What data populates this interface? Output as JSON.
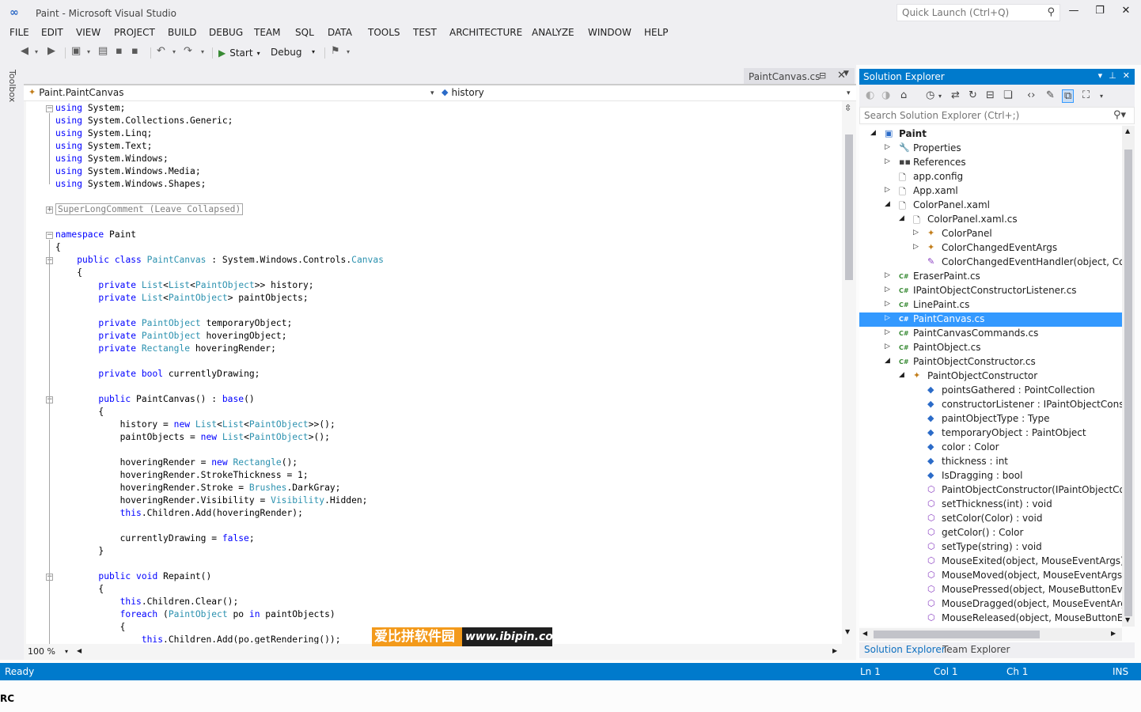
{
  "window": {
    "title": "Paint - Microsoft Visual Studio",
    "quick_launch_placeholder": "Quick Launch (Ctrl+Q)"
  },
  "menu": [
    "FILE",
    "EDIT",
    "VIEW",
    "PROJECT",
    "BUILD",
    "DEBUG",
    "TEAM",
    "SQL",
    "DATA",
    "TOOLS",
    "TEST",
    "ARCHITECTURE",
    "ANALYZE",
    "WINDOW",
    "HELP"
  ],
  "toolbar": {
    "start_label": "Start",
    "config_label": "Debug"
  },
  "toolbox_label": "Toolbox",
  "document_tab": {
    "label": "PaintCanvas.cs"
  },
  "navigation": {
    "left": "Paint.PaintCanvas",
    "right": "history"
  },
  "editor": {
    "zoom": "100 %",
    "lines": [
      [
        [
          "kw",
          "using"
        ],
        [
          "p",
          " System;"
        ]
      ],
      [
        [
          "kw",
          "using"
        ],
        [
          "p",
          " System.Collections.Generic;"
        ]
      ],
      [
        [
          "kw",
          "using"
        ],
        [
          "p",
          " System.Linq;"
        ]
      ],
      [
        [
          "kw",
          "using"
        ],
        [
          "p",
          " System.Text;"
        ]
      ],
      [
        [
          "kw",
          "using"
        ],
        [
          "p",
          " System.Windows;"
        ]
      ],
      [
        [
          "kw",
          "using"
        ],
        [
          "p",
          " System.Windows.Media;"
        ]
      ],
      [
        [
          "kw",
          "using"
        ],
        [
          "p",
          " System.Windows.Shapes;"
        ]
      ],
      [],
      [
        [
          "box",
          "SuperLongComment (Leave Collapsed)"
        ]
      ],
      [],
      [
        [
          "kw",
          "namespace"
        ],
        [
          "p",
          " Paint"
        ]
      ],
      [
        [
          "p",
          "{"
        ]
      ],
      [
        [
          "p",
          "    "
        ],
        [
          "kw",
          "public"
        ],
        [
          "p",
          " "
        ],
        [
          "kw",
          "class"
        ],
        [
          "p",
          " "
        ],
        [
          "ty",
          "PaintCanvas"
        ],
        [
          "p",
          " : System.Windows.Controls."
        ],
        [
          "ty",
          "Canvas"
        ]
      ],
      [
        [
          "p",
          "    {"
        ]
      ],
      [
        [
          "p",
          "        "
        ],
        [
          "kw",
          "private"
        ],
        [
          "p",
          " "
        ],
        [
          "ty",
          "List"
        ],
        [
          "p",
          "<"
        ],
        [
          "ty",
          "List"
        ],
        [
          "p",
          "<"
        ],
        [
          "ty",
          "PaintObject"
        ],
        [
          "p",
          ">> history;"
        ]
      ],
      [
        [
          "p",
          "        "
        ],
        [
          "kw",
          "private"
        ],
        [
          "p",
          " "
        ],
        [
          "ty",
          "List"
        ],
        [
          "p",
          "<"
        ],
        [
          "ty",
          "PaintObject"
        ],
        [
          "p",
          "> paintObjects;"
        ]
      ],
      [],
      [
        [
          "p",
          "        "
        ],
        [
          "kw",
          "private"
        ],
        [
          "p",
          " "
        ],
        [
          "ty",
          "PaintObject"
        ],
        [
          "p",
          " temporaryObject;"
        ]
      ],
      [
        [
          "p",
          "        "
        ],
        [
          "kw",
          "private"
        ],
        [
          "p",
          " "
        ],
        [
          "ty",
          "PaintObject"
        ],
        [
          "p",
          " hoveringObject;"
        ]
      ],
      [
        [
          "p",
          "        "
        ],
        [
          "kw",
          "private"
        ],
        [
          "p",
          " "
        ],
        [
          "ty",
          "Rectangle"
        ],
        [
          "p",
          " hoveringRender;"
        ]
      ],
      [],
      [
        [
          "p",
          "        "
        ],
        [
          "kw",
          "private"
        ],
        [
          "p",
          " "
        ],
        [
          "kw",
          "bool"
        ],
        [
          "p",
          " currentlyDrawing;"
        ]
      ],
      [],
      [
        [
          "p",
          "        "
        ],
        [
          "kw",
          "public"
        ],
        [
          "p",
          " PaintCanvas() : "
        ],
        [
          "kw",
          "base"
        ],
        [
          "p",
          "()"
        ]
      ],
      [
        [
          "p",
          "        {"
        ]
      ],
      [
        [
          "p",
          "            history = "
        ],
        [
          "kw",
          "new"
        ],
        [
          "p",
          " "
        ],
        [
          "ty",
          "List"
        ],
        [
          "p",
          "<"
        ],
        [
          "ty",
          "List"
        ],
        [
          "p",
          "<"
        ],
        [
          "ty",
          "PaintObject"
        ],
        [
          "p",
          ">>();"
        ]
      ],
      [
        [
          "p",
          "            paintObjects = "
        ],
        [
          "kw",
          "new"
        ],
        [
          "p",
          " "
        ],
        [
          "ty",
          "List"
        ],
        [
          "p",
          "<"
        ],
        [
          "ty",
          "PaintObject"
        ],
        [
          "p",
          ">();"
        ]
      ],
      [],
      [
        [
          "p",
          "            hoveringRender = "
        ],
        [
          "kw",
          "new"
        ],
        [
          "p",
          " "
        ],
        [
          "ty",
          "Rectangle"
        ],
        [
          "p",
          "();"
        ]
      ],
      [
        [
          "p",
          "            hoveringRender.StrokeThickness = 1;"
        ]
      ],
      [
        [
          "p",
          "            hoveringRender.Stroke = "
        ],
        [
          "ty",
          "Brushes"
        ],
        [
          "p",
          ".DarkGray;"
        ]
      ],
      [
        [
          "p",
          "            hoveringRender.Visibility = "
        ],
        [
          "ty",
          "Visibility"
        ],
        [
          "p",
          ".Hidden;"
        ]
      ],
      [
        [
          "p",
          "            "
        ],
        [
          "kw",
          "this"
        ],
        [
          "p",
          ".Children.Add(hoveringRender);"
        ]
      ],
      [],
      [
        [
          "p",
          "            currentlyDrawing = "
        ],
        [
          "kw",
          "false"
        ],
        [
          "p",
          ";"
        ]
      ],
      [
        [
          "p",
          "        }"
        ]
      ],
      [],
      [
        [
          "p",
          "        "
        ],
        [
          "kw",
          "public"
        ],
        [
          "p",
          " "
        ],
        [
          "kw",
          "void"
        ],
        [
          "p",
          " Repaint()"
        ]
      ],
      [
        [
          "p",
          "        {"
        ]
      ],
      [
        [
          "p",
          "            "
        ],
        [
          "kw",
          "this"
        ],
        [
          "p",
          ".Children.Clear();"
        ]
      ],
      [
        [
          "p",
          "            "
        ],
        [
          "kw",
          "foreach"
        ],
        [
          "p",
          " ("
        ],
        [
          "ty",
          "PaintObject"
        ],
        [
          "p",
          " po "
        ],
        [
          "kw",
          "in"
        ],
        [
          "p",
          " paintObjects)"
        ]
      ],
      [
        [
          "p",
          "            {"
        ]
      ],
      [
        [
          "p",
          "                "
        ],
        [
          "kw",
          "this"
        ],
        [
          "p",
          ".Children.Add(po.getRendering());"
        ]
      ]
    ]
  },
  "watermark": {
    "cn": "爱比拼软件园",
    "url": "www.ibipin.com"
  },
  "solution_explorer": {
    "title": "Solution Explorer",
    "search_placeholder": "Search Solution Explorer (Ctrl+;)",
    "tabs": [
      "Solution Explorer",
      "Team Explorer"
    ],
    "items": [
      {
        "label": "Paint",
        "depth": 0,
        "expander": "open",
        "icon": "project",
        "bold": true
      },
      {
        "label": "Properties",
        "depth": 1,
        "expander": "closed",
        "icon": "wrench"
      },
      {
        "label": "References",
        "depth": 1,
        "expander": "closed",
        "icon": "references"
      },
      {
        "label": "app.config",
        "depth": 1,
        "expander": "none",
        "icon": "file"
      },
      {
        "label": "App.xaml",
        "depth": 1,
        "expander": "closed",
        "icon": "xaml"
      },
      {
        "label": "ColorPanel.xaml",
        "depth": 1,
        "expander": "open",
        "icon": "xaml"
      },
      {
        "label": "ColorPanel.xaml.cs",
        "depth": 2,
        "expander": "open",
        "icon": "file"
      },
      {
        "label": "ColorPanel",
        "depth": 3,
        "expander": "closed",
        "icon": "class"
      },
      {
        "label": "ColorChangedEventArgs",
        "depth": 3,
        "expander": "closed",
        "icon": "class"
      },
      {
        "label": "ColorChangedEventHandler(object, ColorC",
        "depth": 3,
        "expander": "none",
        "icon": "delegate"
      },
      {
        "label": "EraserPaint.cs",
        "depth": 1,
        "expander": "closed",
        "icon": "cs"
      },
      {
        "label": "IPaintObjectConstructorListener.cs",
        "depth": 1,
        "expander": "closed",
        "icon": "cs"
      },
      {
        "label": "LinePaint.cs",
        "depth": 1,
        "expander": "closed",
        "icon": "cs"
      },
      {
        "label": "PaintCanvas.cs",
        "depth": 1,
        "expander": "closed",
        "icon": "cs",
        "selected": true
      },
      {
        "label": "PaintCanvasCommands.cs",
        "depth": 1,
        "expander": "closed",
        "icon": "cs"
      },
      {
        "label": "PaintObject.cs",
        "depth": 1,
        "expander": "closed",
        "icon": "cs"
      },
      {
        "label": "PaintObjectConstructor.cs",
        "depth": 1,
        "expander": "open",
        "icon": "cs"
      },
      {
        "label": "PaintObjectConstructor",
        "depth": 2,
        "expander": "open",
        "icon": "class"
      },
      {
        "label": "pointsGathered : PointCollection",
        "depth": 3,
        "expander": "none",
        "icon": "field"
      },
      {
        "label": "constructorListener : IPaintObjectConstruct",
        "depth": 3,
        "expander": "none",
        "icon": "field"
      },
      {
        "label": "paintObjectType : Type",
        "depth": 3,
        "expander": "none",
        "icon": "field"
      },
      {
        "label": "temporaryObject : PaintObject",
        "depth": 3,
        "expander": "none",
        "icon": "field"
      },
      {
        "label": "color : Color",
        "depth": 3,
        "expander": "none",
        "icon": "field"
      },
      {
        "label": "thickness : int",
        "depth": 3,
        "expander": "none",
        "icon": "field"
      },
      {
        "label": "IsDragging : bool",
        "depth": 3,
        "expander": "none",
        "icon": "field"
      },
      {
        "label": "PaintObjectConstructor(IPaintObjectConst",
        "depth": 3,
        "expander": "none",
        "icon": "method"
      },
      {
        "label": "setThickness(int) : void",
        "depth": 3,
        "expander": "none",
        "icon": "method"
      },
      {
        "label": "setColor(Color) : void",
        "depth": 3,
        "expander": "none",
        "icon": "method"
      },
      {
        "label": "getColor() : Color",
        "depth": 3,
        "expander": "none",
        "icon": "method"
      },
      {
        "label": "setType(string) : void",
        "depth": 3,
        "expander": "none",
        "icon": "method"
      },
      {
        "label": "MouseExited(object, MouseEventArgs) : vo",
        "depth": 3,
        "expander": "none",
        "icon": "method"
      },
      {
        "label": "MouseMoved(object, MouseEventArgs) : vo",
        "depth": 3,
        "expander": "none",
        "icon": "method"
      },
      {
        "label": "MousePressed(object, MouseButtonEventA",
        "depth": 3,
        "expander": "none",
        "icon": "method"
      },
      {
        "label": "MouseDragged(object, MouseEventArgs) :",
        "depth": 3,
        "expander": "none",
        "icon": "method"
      },
      {
        "label": "MouseReleased(object, MouseButtonEvent",
        "depth": 3,
        "expander": "none",
        "icon": "method"
      }
    ]
  },
  "status": {
    "state": "Ready",
    "line": "Ln 1",
    "col": "Col 1",
    "ch": "Ch 1",
    "mode": "INS"
  },
  "corner_text": "RC",
  "colors": {
    "accent": "#007acc",
    "keyword": "#0000ff",
    "type": "#2b91af",
    "selection": "#3399ff"
  }
}
